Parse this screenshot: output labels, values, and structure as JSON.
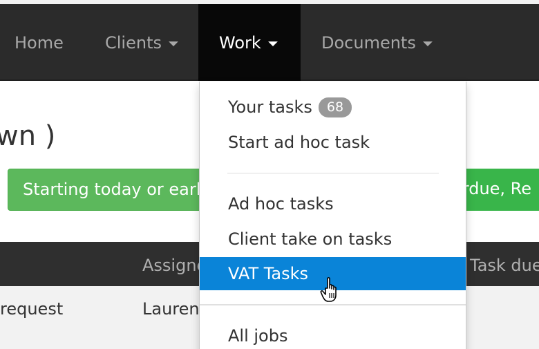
{
  "navbar": {
    "items": [
      {
        "label": "Home"
      },
      {
        "label": "Clients"
      },
      {
        "label": "Work"
      },
      {
        "label": "Documents"
      }
    ],
    "active": "Work"
  },
  "page": {
    "heading": "wn )",
    "filter_green_label": "Starting today or earl",
    "filter_red_label": "erdue, Re"
  },
  "table": {
    "headers": [
      "Assigne",
      "Task due"
    ],
    "row": {
      "col1": "request",
      "col2": "Lauren"
    }
  },
  "dropdown": {
    "your_tasks_label": "Your tasks",
    "your_tasks_count": "68",
    "start_ad_hoc_label": "Start ad hoc task",
    "ad_hoc_tasks_label": "Ad hoc tasks",
    "client_take_on_label": "Client take on tasks",
    "vat_tasks_label": "VAT Tasks",
    "all_jobs_label": "All jobs"
  },
  "colors": {
    "navbar_bg": "#2b2b2b",
    "nav_active_bg": "#080808",
    "dropdown_active": "#0a84d8",
    "filter_green": "#5cb85c",
    "badge_bg": "#999999"
  },
  "icons": {
    "caret": "caret-down-icon",
    "cursor": "hand-pointer-icon"
  }
}
